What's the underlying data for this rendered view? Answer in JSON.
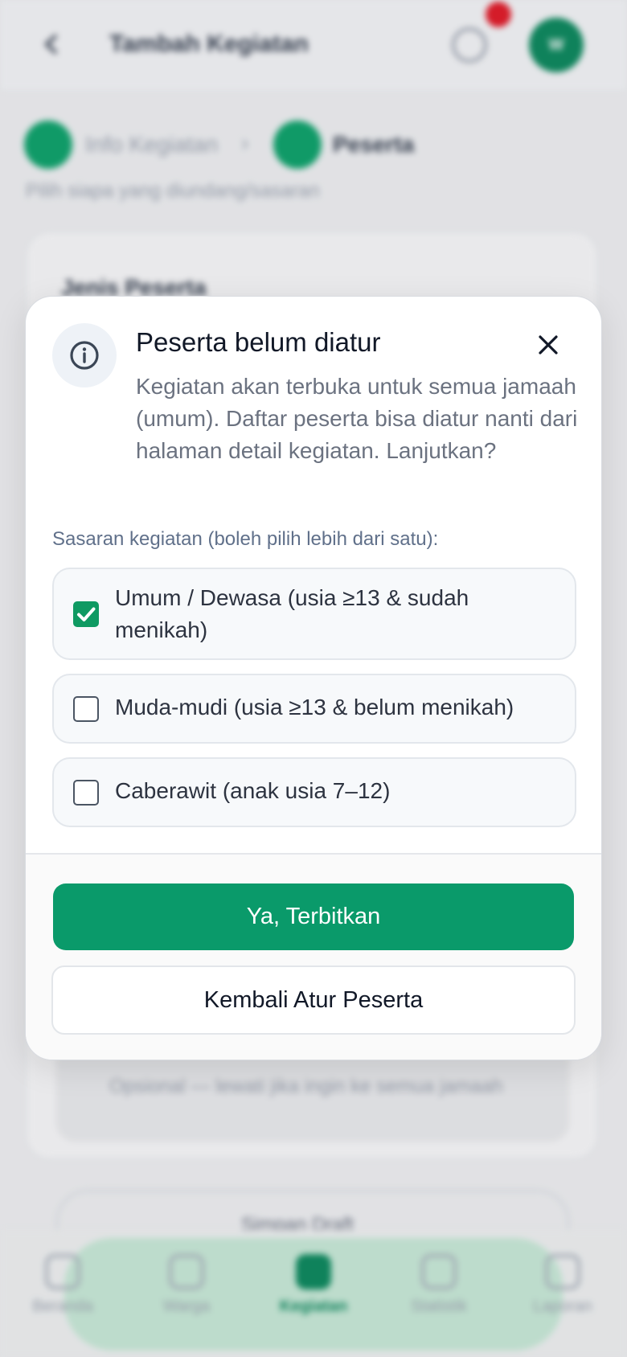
{
  "app": {
    "title": "Tambah Kegiatan",
    "avatar_initials": "W"
  },
  "stepper": {
    "step1_label": "Info Kegiatan",
    "separator": "›",
    "step2_label": "Peserta",
    "hint": "Pilih siapa yang diundang/sasaran"
  },
  "background": {
    "card_title": "Jenis Peserta",
    "empty_text": "Opsional — lewati jika ingin ke semua jamaah",
    "outline_button": "Simpan Draft"
  },
  "bottom_nav": {
    "items": [
      {
        "label": "Beranda",
        "icon": "home-icon"
      },
      {
        "label": "Warga",
        "icon": "users-icon"
      },
      {
        "label": "Kegiatan",
        "icon": "calendar-icon"
      },
      {
        "label": "Statistik",
        "icon": "chart-icon"
      },
      {
        "label": "Laporan",
        "icon": "document-icon"
      }
    ],
    "active_index": 2
  },
  "modal": {
    "icon": "info-icon",
    "title": "Peserta belum diatur",
    "description": "Kegiatan akan terbuka untuk semua jamaah (umum). Daftar peserta bisa diatur nanti dari halaman detail kegiatan. Lanjutkan?",
    "target_label": "Sasaran kegiatan (boleh pilih lebih dari satu):",
    "options": [
      {
        "label": "Umum / Dewasa (usia ≥13 & sudah menikah)",
        "checked": true
      },
      {
        "label": "Muda-mudi (usia ≥13 & belum menikah)",
        "checked": false
      },
      {
        "label": "Caberawit (anak usia 7–12)",
        "checked": false
      }
    ],
    "primary_button": "Ya, Terbitkan",
    "secondary_button": "Kembali Atur Peserta"
  },
  "colors": {
    "primary": "#0a9a6a",
    "checkbox_checked": "#0f9a62",
    "notification": "#e11d2a"
  }
}
